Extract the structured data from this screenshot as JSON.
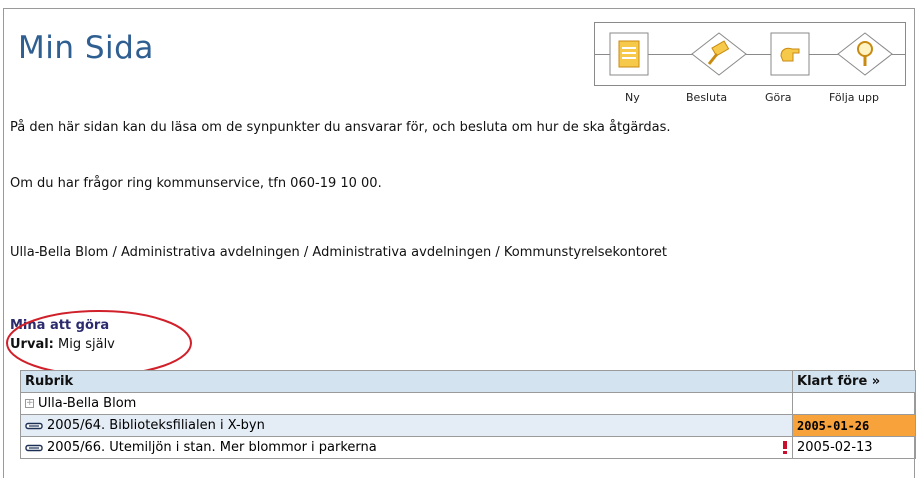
{
  "page": {
    "title": "Min Sida",
    "intro": "På den här sidan kan du läsa om de synpunkter du ansvarar för, och besluta om hur de ska åtgärdas.",
    "contact": "Om du har frågor ring kommunservice, tfn 060-19 10 00.",
    "user_path": "Ulla-Bella Blom / Administrativa avdelningen / Administrativa avdelningen / Kommunstyrelsekontoret"
  },
  "workflow": {
    "steps": [
      {
        "label": "Ny",
        "icon": "document-icon"
      },
      {
        "label": "Besluta",
        "icon": "gavel-icon"
      },
      {
        "label": "Göra",
        "icon": "hand-icon"
      },
      {
        "label": "Följa upp",
        "icon": "magnifier-icon"
      }
    ]
  },
  "todo": {
    "title": "Mina att göra",
    "filter_label": "Urval:",
    "filter_value": " Mig själv",
    "columns": {
      "rubrik": "Rubrik",
      "klart": "Klart före »"
    },
    "rows": [
      {
        "text": "Ulla-Bella Blom",
        "date": "",
        "icon": "expand-icon"
      },
      {
        "text": "2005/64. Biblioteksfilialen i X-byn",
        "date": "2005-01-26",
        "icon": "pen-icon",
        "urgent": true
      },
      {
        "text": "2005/66. Utemiljön i stan. Mer blommor i parkerna",
        "date": "2005-02-13",
        "icon": "pen-icon",
        "flag": "exclamation-icon"
      }
    ]
  },
  "colors": {
    "title": "#2f5f91",
    "header_bg": "#d3e3f0",
    "urgent": "#f7a23b",
    "annotation": "#d0202a"
  }
}
